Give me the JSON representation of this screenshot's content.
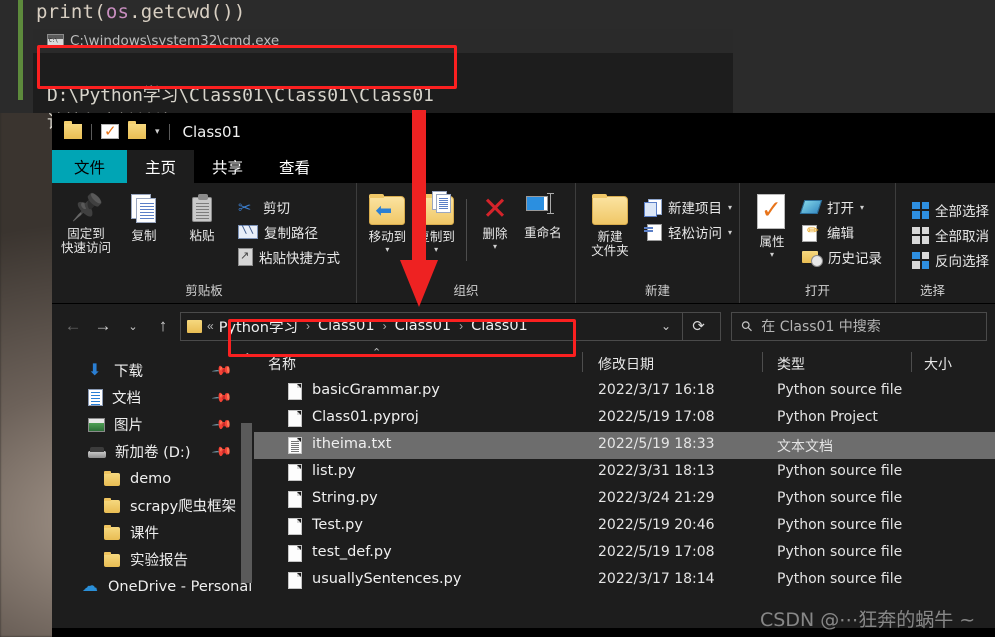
{
  "editor": {
    "code_prefix": "print(",
    "code_module": "os",
    "code_suffix": ".getcwd())"
  },
  "console": {
    "title": "C:\\windows\\system32\\cmd.exe",
    "icon": "cmd-icon",
    "output_path": "D:\\Python学习\\Class01\\Class01\\Class01",
    "prompt_line": "请按任意键继续. . ."
  },
  "explorer": {
    "quick_access": {
      "title": "Class01",
      "icons": [
        "folder-icon",
        "properties-icon",
        "new-folder-icon",
        "chevron-down-icon"
      ]
    },
    "tabs": [
      {
        "label": "文件",
        "name": "tab-file"
      },
      {
        "label": "主页",
        "name": "tab-home"
      },
      {
        "label": "共享",
        "name": "tab-share"
      },
      {
        "label": "查看",
        "name": "tab-view"
      }
    ],
    "ribbon": {
      "groups": [
        {
          "label": "剪贴板",
          "big": [
            {
              "label_line1": "固定到",
              "label_line2": "快速访问",
              "icon": "pin-icon"
            },
            {
              "label_line1": "复制",
              "label_line2": "",
              "icon": "copy-icon"
            },
            {
              "label_line1": "粘贴",
              "label_line2": "",
              "icon": "paste-icon"
            }
          ],
          "small": [
            {
              "label": "剪切",
              "icon": "scissors-icon"
            },
            {
              "label": "复制路径",
              "icon": "copy-path-icon"
            },
            {
              "label": "粘贴快捷方式",
              "icon": "paste-shortcut-icon"
            }
          ]
        },
        {
          "label": "组织",
          "big": [
            {
              "label_line1": "移动到",
              "label_line2": "",
              "icon": "move-to-icon"
            },
            {
              "label_line1": "复制到",
              "label_line2": "",
              "icon": "copy-to-icon"
            },
            {
              "label_line1": "删除",
              "label_line2": "",
              "icon": "delete-icon"
            },
            {
              "label_line1": "重命名",
              "label_line2": "",
              "icon": "rename-icon"
            }
          ]
        },
        {
          "label": "新建",
          "big": [
            {
              "label_line1": "新建",
              "label_line2": "文件夹",
              "icon": "new-folder-icon"
            }
          ],
          "small": [
            {
              "label": "新建项目",
              "icon": "new-item-icon"
            },
            {
              "label": "轻松访问",
              "icon": "easy-access-icon"
            }
          ]
        },
        {
          "label": "打开",
          "big": [
            {
              "label_line1": "属性",
              "label_line2": "",
              "icon": "properties-icon"
            }
          ],
          "small": [
            {
              "label": "打开",
              "icon": "open-icon"
            },
            {
              "label": "编辑",
              "icon": "edit-icon"
            },
            {
              "label": "历史记录",
              "icon": "history-icon"
            }
          ]
        },
        {
          "label": "选择",
          "small": [
            {
              "label": "全部选择",
              "icon": "select-all-icon"
            },
            {
              "label": "全部取消",
              "icon": "select-none-icon"
            },
            {
              "label": "反向选择",
              "icon": "invert-selection-icon"
            }
          ]
        }
      ]
    },
    "address_bar": {
      "back_icon": "back-arrow-icon",
      "forward_icon": "forward-arrow-icon",
      "recent_icon": "chevron-down-icon",
      "up_icon": "up-arrow-icon",
      "breadcrumbs": [
        "Python学习",
        "Class01",
        "Class01",
        "Class01"
      ],
      "separator": "›",
      "overflow": "«",
      "dropdown_icon": "chevron-down-icon",
      "refresh_icon": "refresh-icon"
    },
    "search": {
      "icon": "search-icon",
      "placeholder": "在 Class01 中搜索"
    },
    "nav_pane": {
      "items": [
        {
          "label": "下载",
          "icon": "download-icon",
          "pinned": true,
          "indent": 1
        },
        {
          "label": "文档",
          "icon": "documents-icon",
          "pinned": true,
          "indent": 1
        },
        {
          "label": "图片",
          "icon": "pictures-icon",
          "pinned": true,
          "indent": 1
        },
        {
          "label": "新加卷 (D:)",
          "icon": "drive-icon",
          "pinned": true,
          "indent": 1
        },
        {
          "label": "demo",
          "icon": "folder-icon",
          "pinned": false,
          "indent": 2
        },
        {
          "label": "scrapy爬虫框架",
          "icon": "folder-icon",
          "pinned": false,
          "indent": 2
        },
        {
          "label": "课件",
          "icon": "folder-icon",
          "pinned": false,
          "indent": 2
        },
        {
          "label": "实验报告",
          "icon": "folder-icon",
          "pinned": false,
          "indent": 2
        },
        {
          "label": "OneDrive - Personal",
          "icon": "onedrive-icon",
          "pinned": false,
          "indent": 1
        }
      ]
    },
    "file_list": {
      "columns": [
        "名称",
        "修改日期",
        "类型",
        "大小"
      ],
      "sort_indicator": "ascending",
      "rows": [
        {
          "name": "basicGrammar.py",
          "date": "2022/3/17 16:18",
          "type": "Python source file",
          "size": "",
          "icon": "py-file-icon",
          "selected": false
        },
        {
          "name": "Class01.pyproj",
          "date": "2022/5/19 17:08",
          "type": "Python Project",
          "size": "",
          "icon": "proj-file-icon",
          "selected": false
        },
        {
          "name": "itheima.txt",
          "date": "2022/5/19 18:33",
          "type": "文本文档",
          "size": "",
          "icon": "txt-file-icon",
          "selected": true
        },
        {
          "name": "list.py",
          "date": "2022/3/31 18:13",
          "type": "Python source file",
          "size": "",
          "icon": "py-file-icon",
          "selected": false
        },
        {
          "name": "String.py",
          "date": "2022/3/24 21:29",
          "type": "Python source file",
          "size": "",
          "icon": "py-file-icon",
          "selected": false
        },
        {
          "name": "Test.py",
          "date": "2022/5/19 20:46",
          "type": "Python source file",
          "size": "",
          "icon": "py-file-icon",
          "selected": false
        },
        {
          "name": "test_def.py",
          "date": "2022/5/19 17:08",
          "type": "Python source file",
          "size": "",
          "icon": "py-file-icon",
          "selected": false
        },
        {
          "name": "usuallySentences.py",
          "date": "2022/3/17 18:14",
          "type": "Python source file",
          "size": "",
          "icon": "py-file-icon",
          "selected": false
        }
      ]
    }
  },
  "annotations": {
    "highlight_color": "#fb2020",
    "arrow_color": "#ee2222",
    "box_console_path": "highlight around cmd output path",
    "box_breadcrumb": "highlight around explorer breadcrumb path"
  },
  "watermark": "CSDN @⋯狂奔的蜗牛 ~",
  "colors": {
    "file_tab": "#00a5b5",
    "ribbon_bg": "#1d1d1d",
    "selection": "#6d6d6d"
  }
}
